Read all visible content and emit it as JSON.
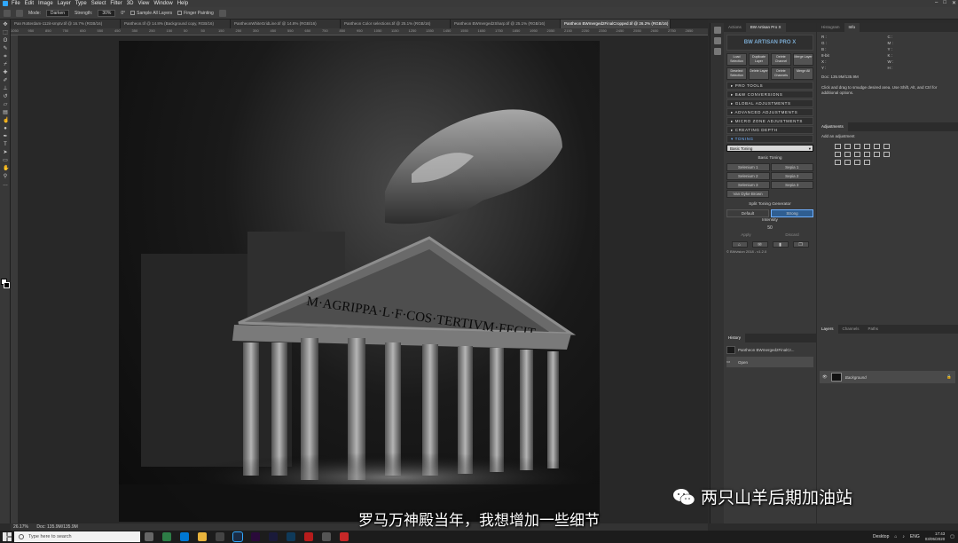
{
  "menubar": {
    "items": [
      "File",
      "Edit",
      "Image",
      "Layer",
      "Type",
      "Select",
      "Filter",
      "3D",
      "View",
      "Window",
      "Help"
    ]
  },
  "options": {
    "mode_label": "Mode:",
    "mode_value": "Darken",
    "strength_label": "Strength:",
    "strength_value": "30%",
    "angle": "0°",
    "sample_all": "Sample All Layers",
    "finger_painting": "Finger Painting"
  },
  "tabs": [
    {
      "label": "Pan Rotterdam-112it-smptv.tif @ 16.7% (RGB/16)"
    },
    {
      "label": "Pantheon.tif @ 14.8% (Background copy, RGB/16)"
    },
    {
      "label": "PantheonWhiteGridLine.tif @ 14.8% (RGB/16)"
    },
    {
      "label": "Pantheon Color selections.tif @ 25.1% (RGB/16)"
    },
    {
      "label": "Pantheon BWmerged2Sharp.tif @ 25.1% (RGB/16)"
    },
    {
      "label": "Pantheon BWmerged2FinalCropped.tif @ 26.2% (RGB/16)"
    }
  ],
  "ruler": [
    "1050",
    "950",
    "850",
    "750",
    "650",
    "550",
    "450",
    "350",
    "250",
    "150",
    "50",
    "50",
    "150",
    "250",
    "350",
    "450",
    "550",
    "650",
    "750",
    "850",
    "950",
    "1050",
    "1150",
    "1250",
    "1350",
    "1450",
    "1550",
    "1650",
    "1750",
    "1850",
    "1950",
    "2050",
    "2150",
    "2250",
    "2350",
    "2450",
    "2550",
    "2650",
    "2750",
    "2850"
  ],
  "photo": {
    "inscription": "M·AGRIPPA·L·F·COS·TERTIVM·FECIT"
  },
  "status": {
    "zoom": "26.17%",
    "doc": "Doc: 135.9M/135.9M"
  },
  "artisan": {
    "tabs": [
      "Actions",
      "BW Artisan Pro X"
    ],
    "logo": "BW ARTISAN PRO X",
    "top_buttons": [
      "Load Selection",
      "Duplicate Layer",
      "Delete Channel",
      "Merge Layer",
      "Deselect Selection",
      "Delete Layer",
      "Delete Channels",
      "Merge All"
    ],
    "sections": [
      "PRO TOOLS",
      "B&W CONVERSIONS",
      "GLOBAL ADJUSTMENTS",
      "ADVANCED ADJUSTMENTS",
      "MICRO ZONE ADJUSTMENTS",
      "CREATING DEPTH",
      "TONING"
    ],
    "dropdown": "Basic Toning",
    "basic_toning": "Basic Toning",
    "tone_buttons": [
      "Selenium 1",
      "Sepia 1",
      "Selenium 2",
      "Sepia 2",
      "Selenium 3",
      "Sepia 3"
    ],
    "vdf": "Van Dyke Brown",
    "split_label": "Split Toning Generator",
    "split_buttons": [
      "Default",
      "Strong"
    ],
    "intensity_label": "Intensity",
    "intensity_value": "50",
    "apply": "Apply",
    "discard": "Discard",
    "footer": "© BWvision 2018 - v1.2.0"
  },
  "history": {
    "title": "History",
    "file": "Pantheon BWmerged2FinalCr...",
    "open": "Open"
  },
  "histogram": {
    "tabs": [
      "Histogram",
      "Info"
    ],
    "rows": [
      [
        "R :",
        "",
        "C :",
        ""
      ],
      [
        "G :",
        "",
        "M :",
        ""
      ],
      [
        "B :",
        "",
        "Y :",
        ""
      ],
      [
        "8-bit",
        "",
        "K :",
        ""
      ],
      [
        "X :",
        "",
        "W :",
        ""
      ],
      [
        "Y :",
        "",
        "H :",
        ""
      ]
    ],
    "doc": "Doc: 135.9M/135.9M",
    "hint": "Click and drag to smudge desired area. Use Shift, Alt, and Ctrl for additional options."
  },
  "adjustments": {
    "tabs": [
      "Adjustments"
    ],
    "add": "Add an adjustment"
  },
  "layers": {
    "tabs": [
      "Layers",
      "Channels",
      "Paths"
    ],
    "layer_name": "Background"
  },
  "overlay": {
    "subtitle": "罗马万神殿当年，我想增加一些细节",
    "watermark": "两只山羊后期加油站"
  },
  "taskbar": {
    "search": "Type here to search",
    "desktop": "Desktop",
    "lang": "ENG",
    "time": "17:43",
    "date": "03/05/2020"
  }
}
